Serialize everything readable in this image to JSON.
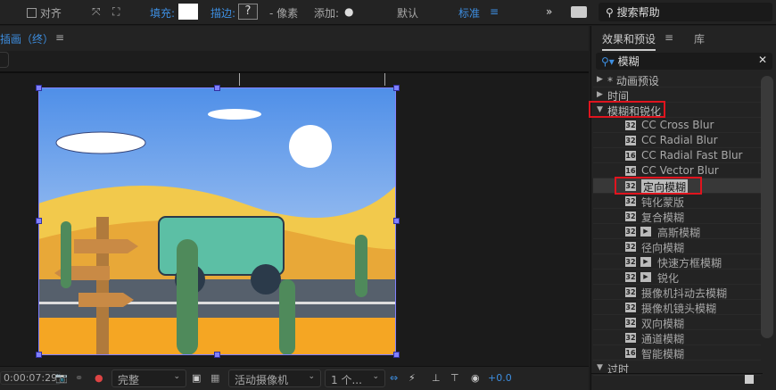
{
  "toolbar": {
    "align": "对齐",
    "fill_label": "填充:",
    "stroke_label": "描边:",
    "stroke_value": "?",
    "pixels": "- 像素",
    "add_label": "添加:",
    "workspace_default": "默认",
    "workspace_standard": "标准",
    "search_help": "搜索帮助"
  },
  "comp": {
    "title": "插画（终）"
  },
  "viewer_bar": {
    "timecode": "0:00:07:29",
    "resolution": "完整",
    "camera": "活动摄像机",
    "views": "1 个...",
    "exposure": "+0.0"
  },
  "effects_panel": {
    "tab_effects": "效果和预设",
    "tab_library": "库",
    "search_value": "模糊",
    "items": [
      {
        "label": "* 动画预设",
        "type": "folder",
        "expanded": false
      },
      {
        "label": "时间",
        "type": "folder",
        "expanded": false
      },
      {
        "label": "模糊和锐化",
        "type": "folder",
        "expanded": true,
        "highlighted": true
      },
      {
        "label": "CC Cross Blur",
        "badge": "32"
      },
      {
        "label": "CC Radial Blur",
        "badge": "32"
      },
      {
        "label": "CC Radial Fast Blur",
        "badge": "16"
      },
      {
        "label": "CC Vector Blur",
        "badge": "16"
      },
      {
        "label": "定向模糊",
        "badge": "32",
        "selected": true,
        "highlighted": true
      },
      {
        "label": "钝化蒙版",
        "badge": "32"
      },
      {
        "label": "复合模糊",
        "badge": "32"
      },
      {
        "label": "高斯模糊",
        "badge": "32",
        "gpu": true
      },
      {
        "label": "径向模糊",
        "badge": "32"
      },
      {
        "label": "快速方框模糊",
        "badge": "32",
        "gpu": true
      },
      {
        "label": "锐化",
        "badge": "32",
        "gpu": true
      },
      {
        "label": "摄像机抖动去模糊",
        "badge": "32"
      },
      {
        "label": "摄像机镜头模糊",
        "badge": "32"
      },
      {
        "label": "双向模糊",
        "badge": "32"
      },
      {
        "label": "通道模糊",
        "badge": "32"
      },
      {
        "label": "智能模糊",
        "badge": "16"
      },
      {
        "label": "过时",
        "type": "folder",
        "expanded": true
      }
    ]
  },
  "colors": {
    "accent": "#3d8ee0",
    "highlight": "#e0141e"
  }
}
